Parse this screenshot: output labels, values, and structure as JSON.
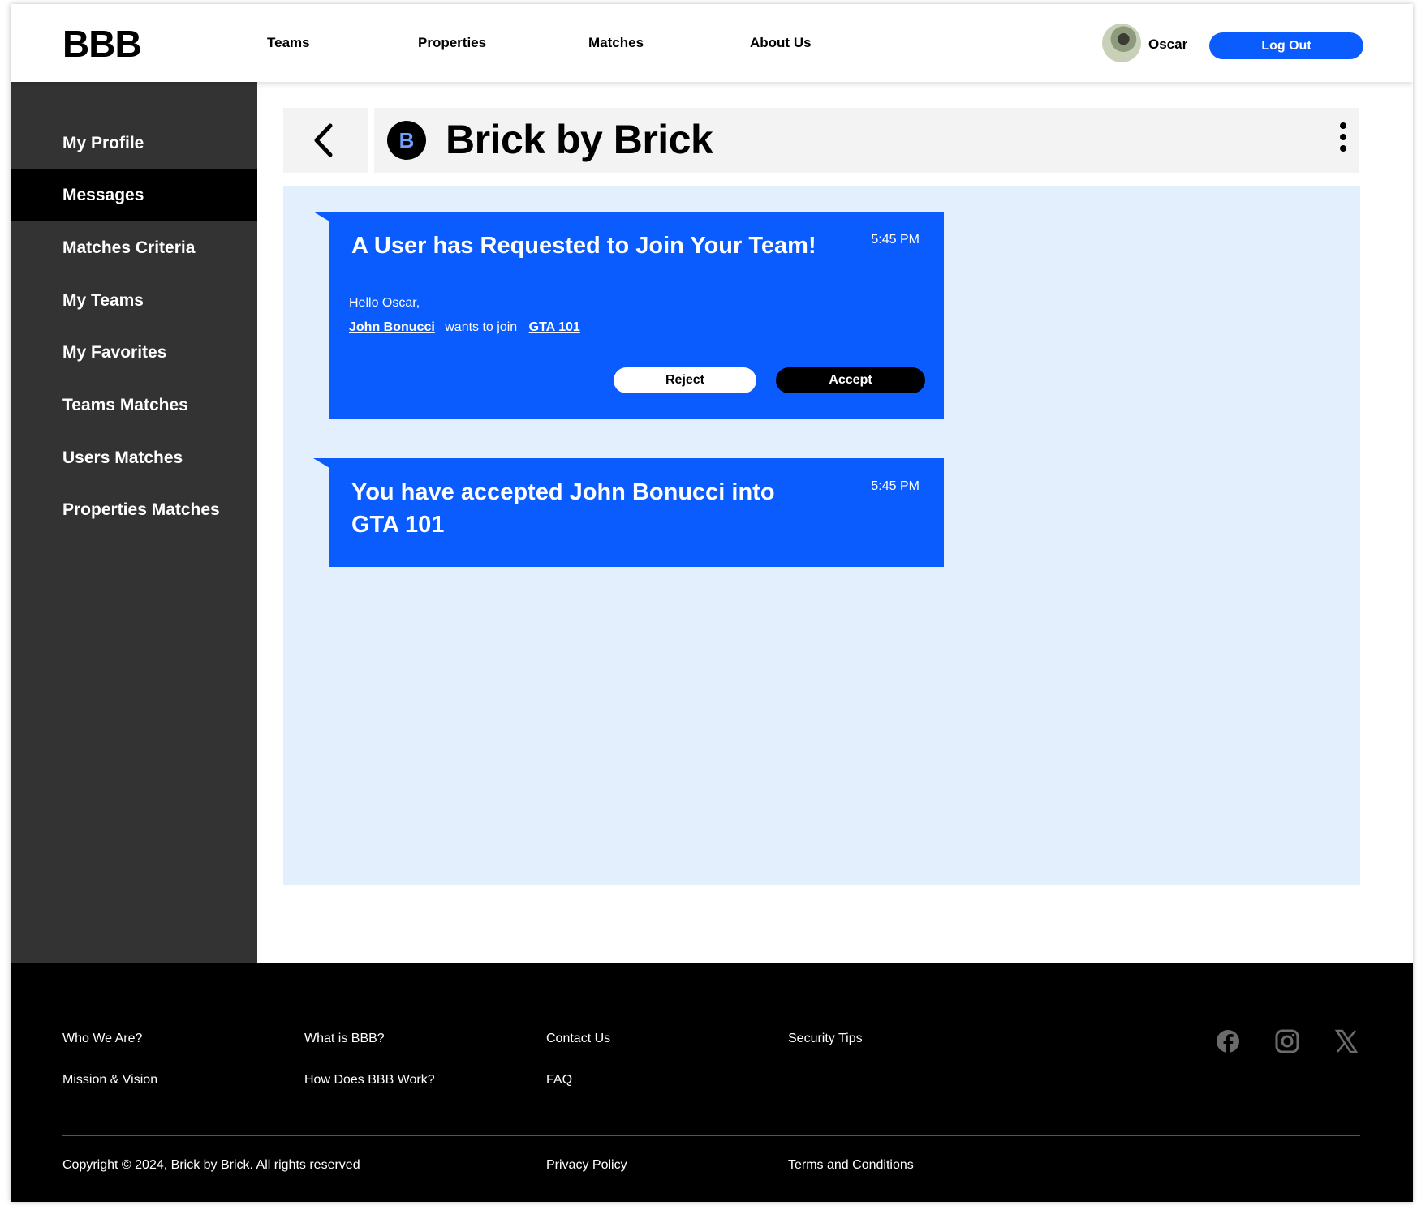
{
  "header": {
    "logo": "BBB",
    "nav": [
      "Teams",
      "Properties",
      "Matches",
      "About Us"
    ],
    "user_name": "Oscar",
    "logout_label": "Log Out"
  },
  "sidebar": {
    "items": [
      {
        "label": "My Profile"
      },
      {
        "label": "Messages"
      },
      {
        "label": "Matches Criteria"
      },
      {
        "label": "My Teams"
      },
      {
        "label": "My Favorites"
      },
      {
        "label": "Teams Matches"
      },
      {
        "label": "Users Matches"
      },
      {
        "label": "Properties Matches"
      }
    ],
    "active": "Messages"
  },
  "chat": {
    "badge_letter": "B",
    "title": "Brick by Brick"
  },
  "messages": [
    {
      "title": "A User has Requested to Join Your Team!",
      "time": "5:45 PM",
      "greeting": "Hello Oscar,",
      "user_link": "John Bonucci",
      "middle_text": "wants to join",
      "team_link": "GTA 101",
      "reject_label": "Reject",
      "accept_label": "Accept"
    },
    {
      "title_line1": "You have accepted John Bonucci into",
      "title_line2": "GTA 101",
      "time": "5:45 PM"
    }
  ],
  "footer": {
    "col1": [
      "Who We Are?",
      "Mission & Vision"
    ],
    "col2": [
      "What is BBB?",
      "How Does BBB Work?"
    ],
    "col3": [
      "Contact Us",
      "FAQ"
    ],
    "col4": [
      "Security Tips"
    ],
    "copyright": "Copyright © 2024, Brick by Brick. All rights reserved",
    "privacy": "Privacy Policy",
    "terms": "Terms and Conditions",
    "social_icons": [
      "facebook-icon",
      "instagram-icon",
      "x-icon"
    ]
  },
  "colors": {
    "accent": "#0A5CFF",
    "sidebar": "#333333",
    "message_area": "#E3EFFD"
  }
}
